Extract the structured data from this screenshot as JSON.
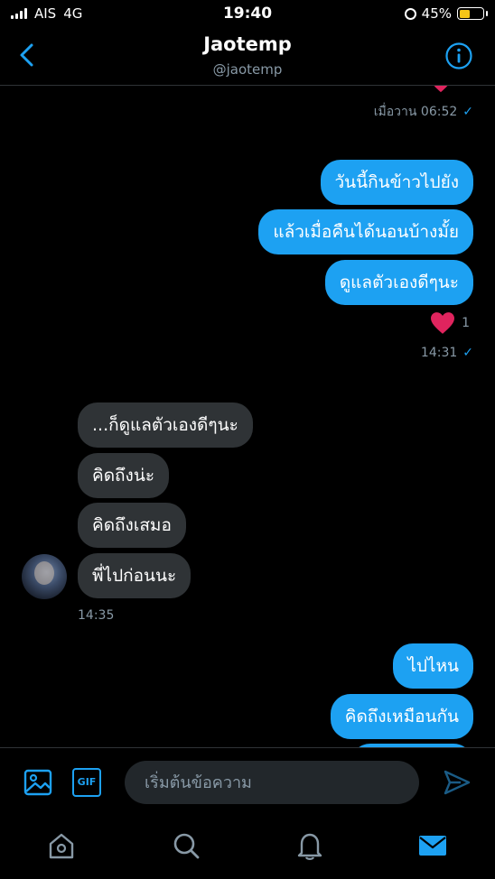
{
  "status_bar": {
    "carrier": "AIS",
    "network": "4G",
    "time": "19:40",
    "battery": "45%"
  },
  "header": {
    "title": "Jaotemp",
    "handle": "@jaotemp"
  },
  "messages": {
    "earlier_time": "เมื่อวาน 06:52",
    "out1": "วันนี้กินข้าวไปยัง",
    "out2": "แล้วเมื่อคืนได้นอนบ้างมั้ย",
    "out3": "ดูแลตัวเองดีๆนะ",
    "like_count": "1",
    "out_time": "14:31",
    "in1": "...ก็ดูแลตัวเองดีๆนะ",
    "in2": "คิดถึงน่ะ",
    "in3": "คิดถึงเสมอ",
    "in4": "พี่ไปก่อนนะ",
    "in_time": "14:35",
    "out4": "ไปไหน",
    "out5": "คิดถึงเหมือนกัน"
  },
  "composer": {
    "placeholder": "เริ่มต้นข้อความ",
    "gif_label": "GIF"
  },
  "colors": {
    "accent": "#1da1f2",
    "incoming_bubble": "#2f3336",
    "heart": "#e0245e"
  },
  "icons": [
    "back-icon",
    "info-icon",
    "heart-icon",
    "image-icon",
    "gif-icon",
    "send-icon",
    "home-icon",
    "search-icon",
    "bell-icon",
    "mail-icon"
  ]
}
